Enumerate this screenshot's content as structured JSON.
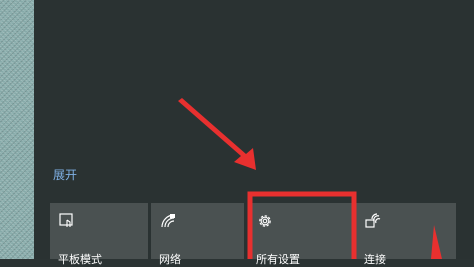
{
  "action_center": {
    "expand_label": "展开",
    "tiles": [
      {
        "label": "平板模式",
        "icon": "tablet-mode-icon"
      },
      {
        "label": "网络",
        "icon": "network-icon"
      },
      {
        "label": "所有设置",
        "icon": "gear-icon"
      },
      {
        "label": "连接",
        "icon": "connect-icon"
      }
    ]
  },
  "annotations": {
    "color": "#e8302f"
  }
}
